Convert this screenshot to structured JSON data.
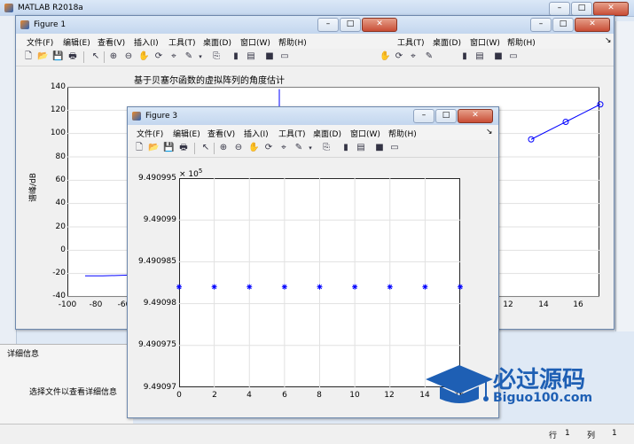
{
  "matlab": {
    "title": "MATLAB R2018a",
    "toolbar_labels": [
      "工具(T)",
      "桌面(D)",
      "窗口(W)",
      "帮助(H)"
    ],
    "details_header": "详细信息",
    "details_text": "选择文件以查看详细信息",
    "status": {
      "row_label": "行",
      "row_value": "1",
      "col_label": "列",
      "col_value": "1"
    }
  },
  "figure1": {
    "title": "Figure 1",
    "menu": [
      "文件(F)",
      "编辑(E)",
      "查看(V)",
      "插入(I)",
      "工具(T)",
      "桌面(D)",
      "窗口(W)",
      "帮助(H)"
    ],
    "plot_title": "基于贝塞尔函数的虚拟阵列的角度估计",
    "ylabel": "谱峰/dB",
    "yticks": [
      "140",
      "120",
      "100",
      "80",
      "60",
      "40",
      "20",
      "0",
      "-20",
      "-40"
    ],
    "xticks_left": [
      "-100",
      "-80",
      "-60"
    ],
    "xticks_right": [
      "12",
      "14",
      "16"
    ]
  },
  "figure3": {
    "title": "Figure 3",
    "menu": [
      "文件(F)",
      "编辑(E)",
      "查看(V)",
      "插入(I)",
      "工具(T)",
      "桌面(D)",
      "窗口(W)",
      "帮助(H)"
    ],
    "exponent": "× 10",
    "exponent_power": "5",
    "yticks": [
      "9.490995",
      "9.49099",
      "9.490985",
      "9.49098",
      "9.490975",
      "9.49097"
    ],
    "xticks": [
      "0",
      "2",
      "4",
      "6",
      "8",
      "10",
      "12",
      "14",
      "16"
    ]
  },
  "watermark": {
    "cn": "必过源码",
    "url": "Biguo100.com"
  },
  "colors": {
    "line": "#0000ff",
    "accent": "#1e5fb4"
  },
  "chart_data": [
    {
      "type": "line",
      "title": "基于贝塞尔函数的虚拟阵列的角度估计",
      "ylabel": "谱峰/dB",
      "ylim": [
        -40,
        140
      ],
      "x": [
        -90,
        -80,
        -60,
        12,
        14,
        16
      ],
      "y": [
        -22,
        -22,
        -21,
        95,
        110,
        125
      ]
    },
    {
      "type": "scatter",
      "xlim": [
        0,
        16
      ],
      "ylim": [
        949097,
        949099.5
      ],
      "x": [
        0,
        2,
        4,
        6,
        8,
        10,
        12,
        14,
        16
      ],
      "y": [
        949098.2,
        949098.2,
        949098.2,
        949098.2,
        949098.2,
        949098.2,
        949098.2,
        949098.2,
        949098.2
      ]
    }
  ]
}
